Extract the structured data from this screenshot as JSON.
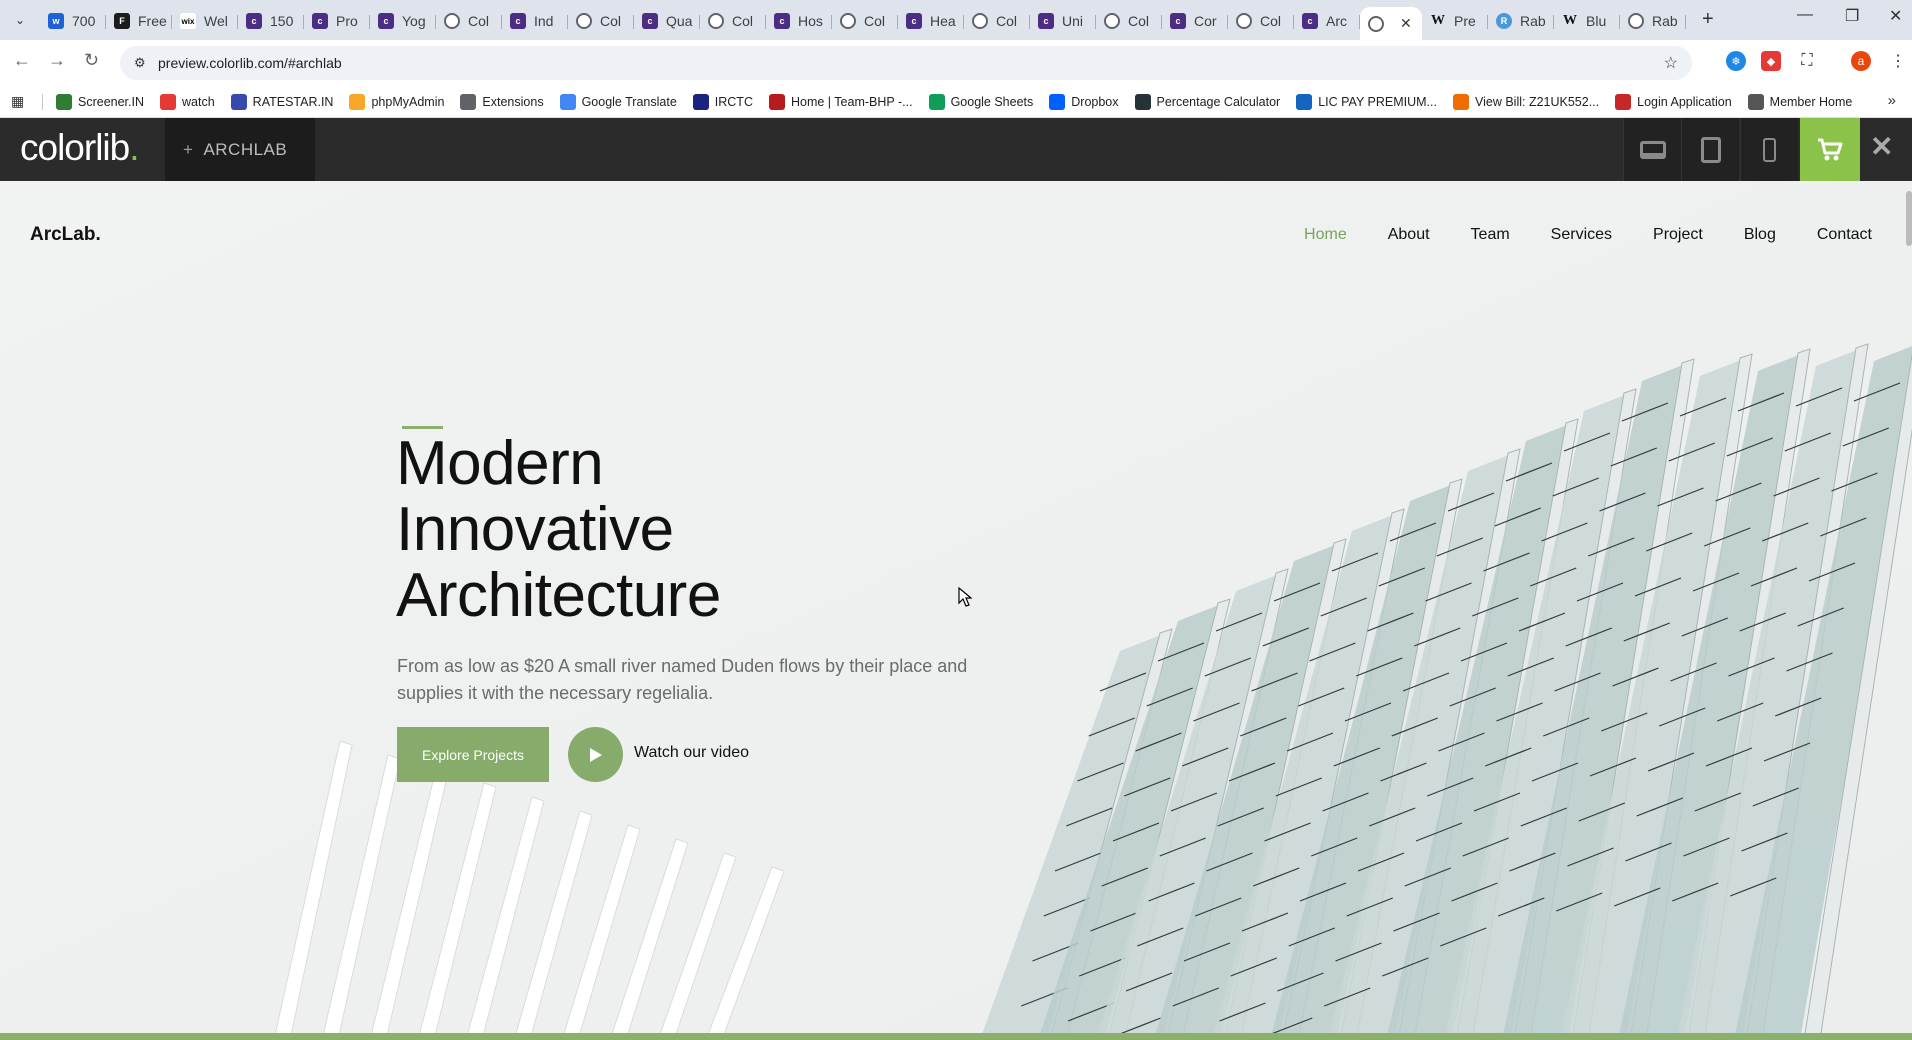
{
  "browser": {
    "tabs": [
      {
        "title": "700",
        "icon": "blue-w"
      },
      {
        "title": "Free",
        "icon": "dark-f"
      },
      {
        "title": "Wel",
        "icon": "wix"
      },
      {
        "title": "150",
        "icon": "purple"
      },
      {
        "title": "Pro",
        "icon": "purple"
      },
      {
        "title": "Yog",
        "icon": "purple"
      },
      {
        "title": "Col",
        "icon": "globe"
      },
      {
        "title": "Ind",
        "icon": "purple"
      },
      {
        "title": "Col",
        "icon": "globe"
      },
      {
        "title": "Qua",
        "icon": "purple"
      },
      {
        "title": "Col",
        "icon": "globe"
      },
      {
        "title": "Hos",
        "icon": "purple"
      },
      {
        "title": "Col",
        "icon": "globe"
      },
      {
        "title": "Hea",
        "icon": "purple"
      },
      {
        "title": "Col",
        "icon": "globe"
      },
      {
        "title": "Uni",
        "icon": "purple"
      },
      {
        "title": "Col",
        "icon": "globe"
      },
      {
        "title": "Cor",
        "icon": "purple"
      },
      {
        "title": "Col",
        "icon": "globe"
      },
      {
        "title": "Arc",
        "icon": "purple"
      },
      {
        "title": "",
        "icon": "globe",
        "active": true
      },
      {
        "title": "Pre",
        "icon": "wiki"
      },
      {
        "title": "Rab",
        "icon": "rb"
      },
      {
        "title": "Blu",
        "icon": "wiki"
      },
      {
        "title": "Rab",
        "icon": "globe"
      }
    ],
    "url": "preview.colorlib.com/#archlab",
    "profile_initial": "a",
    "bookmarks": [
      {
        "label": "Screener.IN",
        "color": "#2e7d32"
      },
      {
        "label": "watch",
        "color": "#e53935"
      },
      {
        "label": "RATESTAR.IN",
        "color": "#3949ab"
      },
      {
        "label": "phpMyAdmin",
        "color": "#f9a825"
      },
      {
        "label": "Extensions",
        "color": "#5f6368"
      },
      {
        "label": "Google Translate",
        "color": "#4285f4"
      },
      {
        "label": "IRCTC",
        "color": "#1a237e"
      },
      {
        "label": "Home | Team-BHP -...",
        "color": "#b71c1c"
      },
      {
        "label": "Google Sheets",
        "color": "#0f9d58"
      },
      {
        "label": "Dropbox",
        "color": "#0061fe"
      },
      {
        "label": "Percentage Calculator",
        "color": "#263238"
      },
      {
        "label": "LIC PAY PREMIUM...",
        "color": "#1565c0"
      },
      {
        "label": "View Bill: Z21UK552...",
        "color": "#ef6c00"
      },
      {
        "label": "Login Application",
        "color": "#c62828"
      },
      {
        "label": "Member Home",
        "color": "#555555"
      }
    ]
  },
  "colorlib": {
    "logo_text": "colorlib",
    "logo_dot": ".",
    "theme_plus": "+",
    "theme_name": "ARCHLAB",
    "accent_color": "#8bc34a"
  },
  "site": {
    "logo": "ArcLab.",
    "nav": [
      "Home",
      "About",
      "Team",
      "Services",
      "Project",
      "Blog",
      "Contact"
    ],
    "active_nav": "Home",
    "hero": {
      "title_line1": "Modern",
      "title_line2": "Innovative",
      "title_line3": "Architecture",
      "description_line1": "From as low as $20 A small river named Duden flows by their place and",
      "description_line2": "supplies it with the necessary regelialia.",
      "primary_button": "Explore Projects",
      "video_label": "Watch our video"
    },
    "brand_green": "#86ab6a"
  }
}
